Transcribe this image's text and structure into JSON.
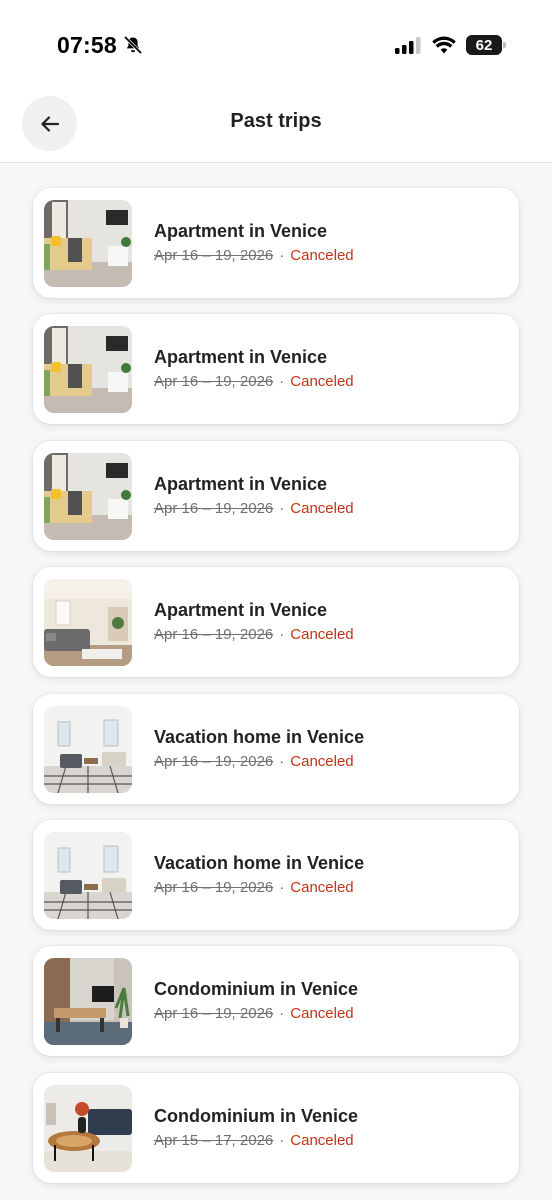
{
  "status_bar": {
    "time": "07:58",
    "battery": "62"
  },
  "header": {
    "title": "Past trips"
  },
  "trips": [
    {
      "title": "Apartment in Venice",
      "dates": "Apr 16 – 19, 2026",
      "status": "Canceled",
      "photo": "apt-a"
    },
    {
      "title": "Apartment in Venice",
      "dates": "Apr 16 – 19, 2026",
      "status": "Canceled",
      "photo": "apt-a"
    },
    {
      "title": "Apartment in Venice",
      "dates": "Apr 16 – 19, 2026",
      "status": "Canceled",
      "photo": "apt-a"
    },
    {
      "title": "Apartment in Venice",
      "dates": "Apr 16 – 19, 2026",
      "status": "Canceled",
      "photo": "apt-b"
    },
    {
      "title": "Vacation home in Venice",
      "dates": "Apr 16 – 19, 2026",
      "status": "Canceled",
      "photo": "villa"
    },
    {
      "title": "Vacation home in Venice",
      "dates": "Apr 16 – 19, 2026",
      "status": "Canceled",
      "photo": "villa"
    },
    {
      "title": "Condominium in Venice",
      "dates": "Apr 16 – 19, 2026",
      "status": "Canceled",
      "photo": "condo-a"
    },
    {
      "title": "Condominium in Venice",
      "dates": "Apr 15 – 17, 2026",
      "status": "Canceled",
      "photo": "condo-b"
    }
  ],
  "colors": {
    "canceled": "#c13515",
    "muted": "#717171",
    "text": "#222222"
  }
}
